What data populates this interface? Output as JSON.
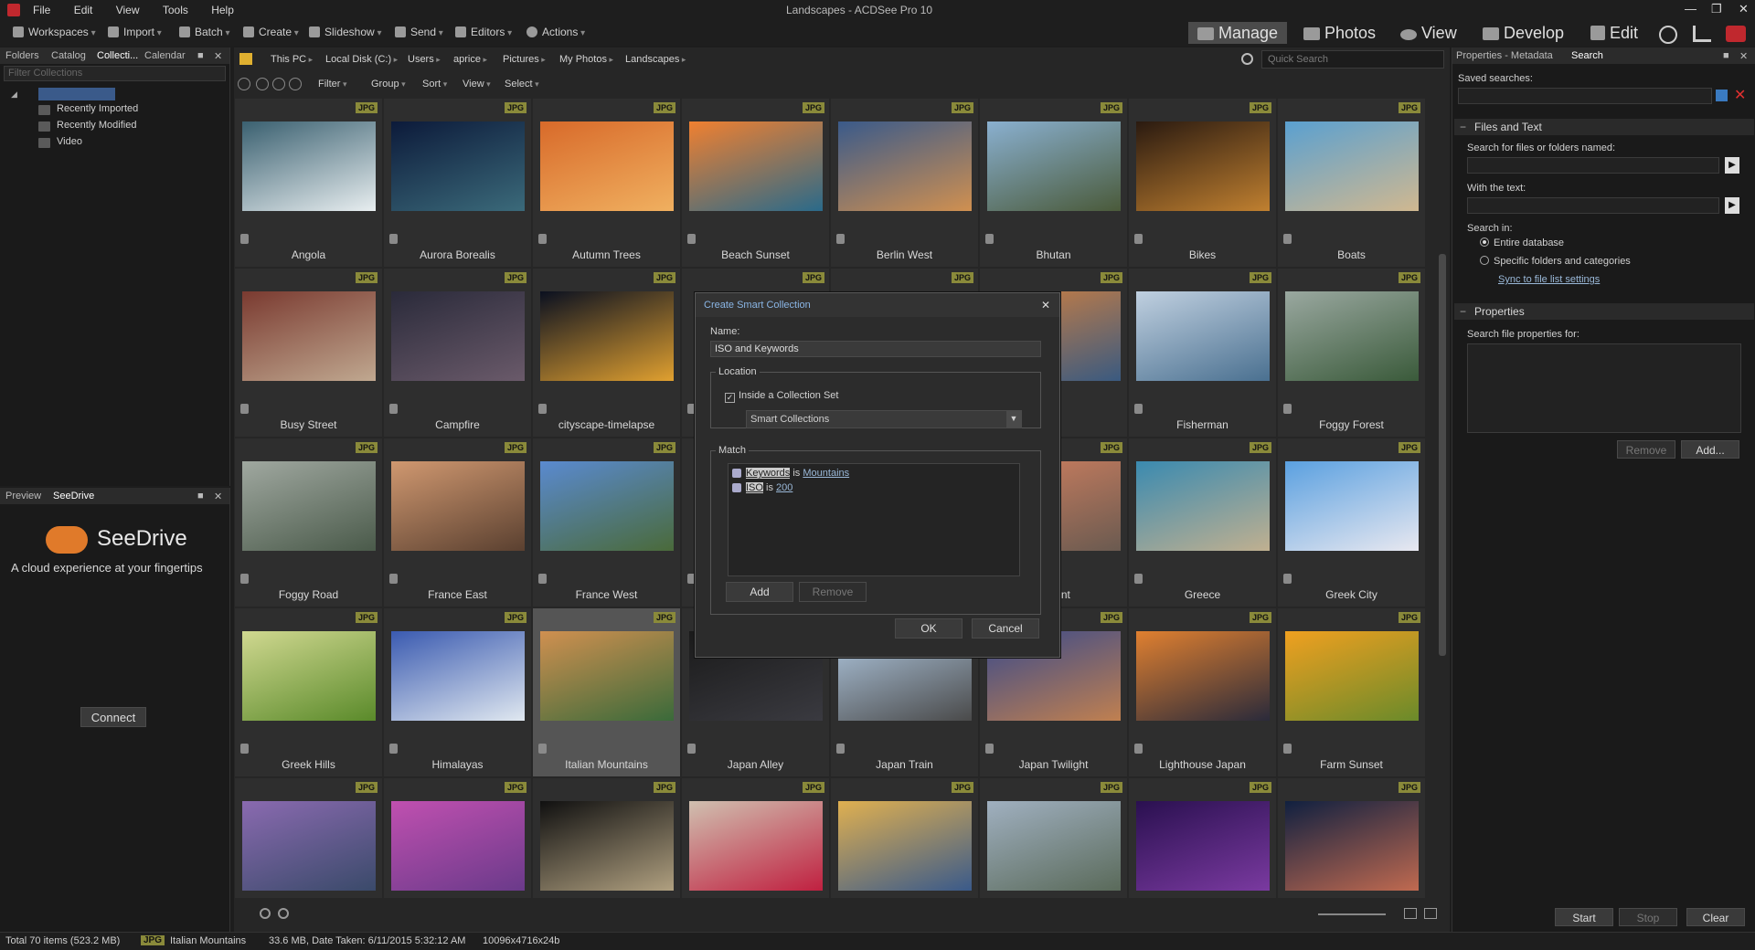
{
  "window": {
    "title": "Landscapes - ACDSee Pro 10",
    "menu": [
      "File",
      "Edit",
      "View",
      "Tools",
      "Help"
    ]
  },
  "toolbar": {
    "items": [
      "Workspaces",
      "Import",
      "Batch",
      "Create",
      "Slideshow",
      "Send",
      "Editors",
      "Actions"
    ]
  },
  "modes": [
    "Manage",
    "Photos",
    "View",
    "Develop",
    "Edit"
  ],
  "left_panel": {
    "tabs": [
      "Folders",
      "Catalog",
      "Collecti...",
      "Calendar"
    ],
    "filter_placeholder": "Filter Collections",
    "tree": [
      "Recently Imported",
      "Recently Modified",
      "Video"
    ]
  },
  "seedrive": {
    "tabs": [
      "Preview",
      "SeeDrive"
    ],
    "title": "SeeDrive",
    "tagline": "A cloud experience at your fingertips",
    "connect": "Connect"
  },
  "breadcrumb": [
    "This PC",
    "Local Disk (C:)",
    "Users",
    "aprice",
    "Pictures",
    "My Photos",
    "Landscapes"
  ],
  "quick_search": "Quick Search",
  "filterbar": [
    "Filter",
    "Group",
    "Sort",
    "View",
    "Select"
  ],
  "badge": "JPG",
  "photos": [
    {
      "name": "Angola",
      "c1": "#3a6070",
      "c2": "#e8eef0"
    },
    {
      "name": "Aurora Borealis",
      "c1": "#0c1a3a",
      "c2": "#3b6a7a"
    },
    {
      "name": "Autumn Trees",
      "c1": "#d86a2a",
      "c2": "#f0b060"
    },
    {
      "name": "Beach Sunset",
      "c1": "#f08030",
      "c2": "#2a6a8a"
    },
    {
      "name": "Berlin West",
      "c1": "#3a5a8a",
      "c2": "#d09050"
    },
    {
      "name": "Bhutan",
      "c1": "#8ab0d0",
      "c2": "#4a5a3a"
    },
    {
      "name": "Bikes",
      "c1": "#2a1a10",
      "c2": "#c08030"
    },
    {
      "name": "Boats",
      "c1": "#5aa0d0",
      "c2": "#d0b890"
    },
    {
      "name": "Busy Street",
      "c1": "#7a3a30",
      "c2": "#c0a890"
    },
    {
      "name": "Campfire",
      "c1": "#2a2a3a",
      "c2": "#6a5a6a"
    },
    {
      "name": "cityscape-timelapse",
      "c1": "#0a1020",
      "c2": "#e0a030"
    },
    {
      "name": "",
      "c1": "#2e2e2e",
      "c2": "#2e2e2e"
    },
    {
      "name": "",
      "c1": "#2e2e2e",
      "c2": "#2e2e2e"
    },
    {
      "name": "",
      "c1": "#d08040",
      "c2": "#3a5a80"
    },
    {
      "name": "Fisherman",
      "c1": "#c0d0e0",
      "c2": "#4a7090"
    },
    {
      "name": "Foggy Forest",
      "c1": "#9aa8a0",
      "c2": "#3a5a3a"
    },
    {
      "name": "Foggy Road",
      "c1": "#a0a8a0",
      "c2": "#4a5a4a"
    },
    {
      "name": "France East",
      "c1": "#d09870",
      "c2": "#5a4030"
    },
    {
      "name": "France West",
      "c1": "#5a8ad0",
      "c2": "#4a6a3a"
    },
    {
      "name": "",
      "c1": "#2e2e2e",
      "c2": "#2e2e2e"
    },
    {
      "name": "",
      "c1": "#2e2e2e",
      "c2": "#2e2e2e"
    },
    {
      "name": "ephant",
      "c1": "#d08060",
      "c2": "#6a5a50"
    },
    {
      "name": "Greece",
      "c1": "#3a8ab0",
      "c2": "#c0b090"
    },
    {
      "name": "Greek City",
      "c1": "#5aa0e0",
      "c2": "#e8e8f0"
    },
    {
      "name": "Greek Hills",
      "c1": "#d0d890",
      "c2": "#5a8a2a"
    },
    {
      "name": "Himalayas",
      "c1": "#3a5ab0",
      "c2": "#e0e8f0"
    },
    {
      "name": "Italian Mountains",
      "c1": "#d09050",
      "c2": "#3a6a3a"
    },
    {
      "name": "Japan Alley",
      "c1": "#1a1a1a",
      "c2": "#3a3a40"
    },
    {
      "name": "Japan Train",
      "c1": "#b0c8e0",
      "c2": "#4a4a4a"
    },
    {
      "name": "Japan Twilight",
      "c1": "#3a4a8a",
      "c2": "#c08050"
    },
    {
      "name": "Lighthouse Japan",
      "c1": "#e08030",
      "c2": "#2a2a3a"
    },
    {
      "name": "Farm Sunset",
      "c1": "#f0a020",
      "c2": "#6a8a2a"
    },
    {
      "name": "",
      "c1": "#8a6ab0",
      "c2": "#3a4a6a"
    },
    {
      "name": "",
      "c1": "#c050b0",
      "c2": "#6a3a8a"
    },
    {
      "name": "",
      "c1": "#101010",
      "c2": "#b0a080"
    },
    {
      "name": "",
      "c1": "#d0c0b0",
      "c2": "#c02040"
    },
    {
      "name": "",
      "c1": "#e0b050",
      "c2": "#3a5a8a"
    },
    {
      "name": "",
      "c1": "#a0b0c0",
      "c2": "#5a6a5a"
    },
    {
      "name": "",
      "c1": "#2a1050",
      "c2": "#7a3aa0"
    },
    {
      "name": "",
      "c1": "#102040",
      "c2": "#c06a50"
    }
  ],
  "dialog": {
    "title": "Create Smart Collection",
    "name_label": "Name:",
    "name_value": "ISO and Keywords",
    "location_label": "Location",
    "inside_label": "Inside a Collection Set",
    "collection_set": "Smart Collections",
    "match_label": "Match",
    "rules": [
      {
        "field": "Keywords",
        "op": "is",
        "value": "Mountains"
      },
      {
        "field": "ISO",
        "op": "is",
        "value": "200"
      }
    ],
    "add": "Add",
    "remove": "Remove",
    "ok": "OK",
    "cancel": "Cancel"
  },
  "right_panel": {
    "tabs": [
      "Properties - Metadata",
      "Search"
    ],
    "saved_searches": "Saved searches:",
    "files_text": "Files and Text",
    "search_files": "Search for files or folders named:",
    "with_text": "With the text:",
    "search_in": "Search in:",
    "entire_db": "Entire database",
    "specific": "Specific folders and categories",
    "sync": "Sync to file list settings",
    "properties": "Properties",
    "search_props": "Search file properties for:",
    "remove": "Remove",
    "add": "Add...",
    "start": "Start",
    "stop": "Stop",
    "clear": "Clear"
  },
  "status": {
    "total": "Total 70 items  (523.2 MB)",
    "type": "JPG",
    "file": "Italian Mountains",
    "info": "33.6 MB, Date Taken: 6/11/2015 5:32:12 AM",
    "dims": "10096x4716x24b"
  }
}
